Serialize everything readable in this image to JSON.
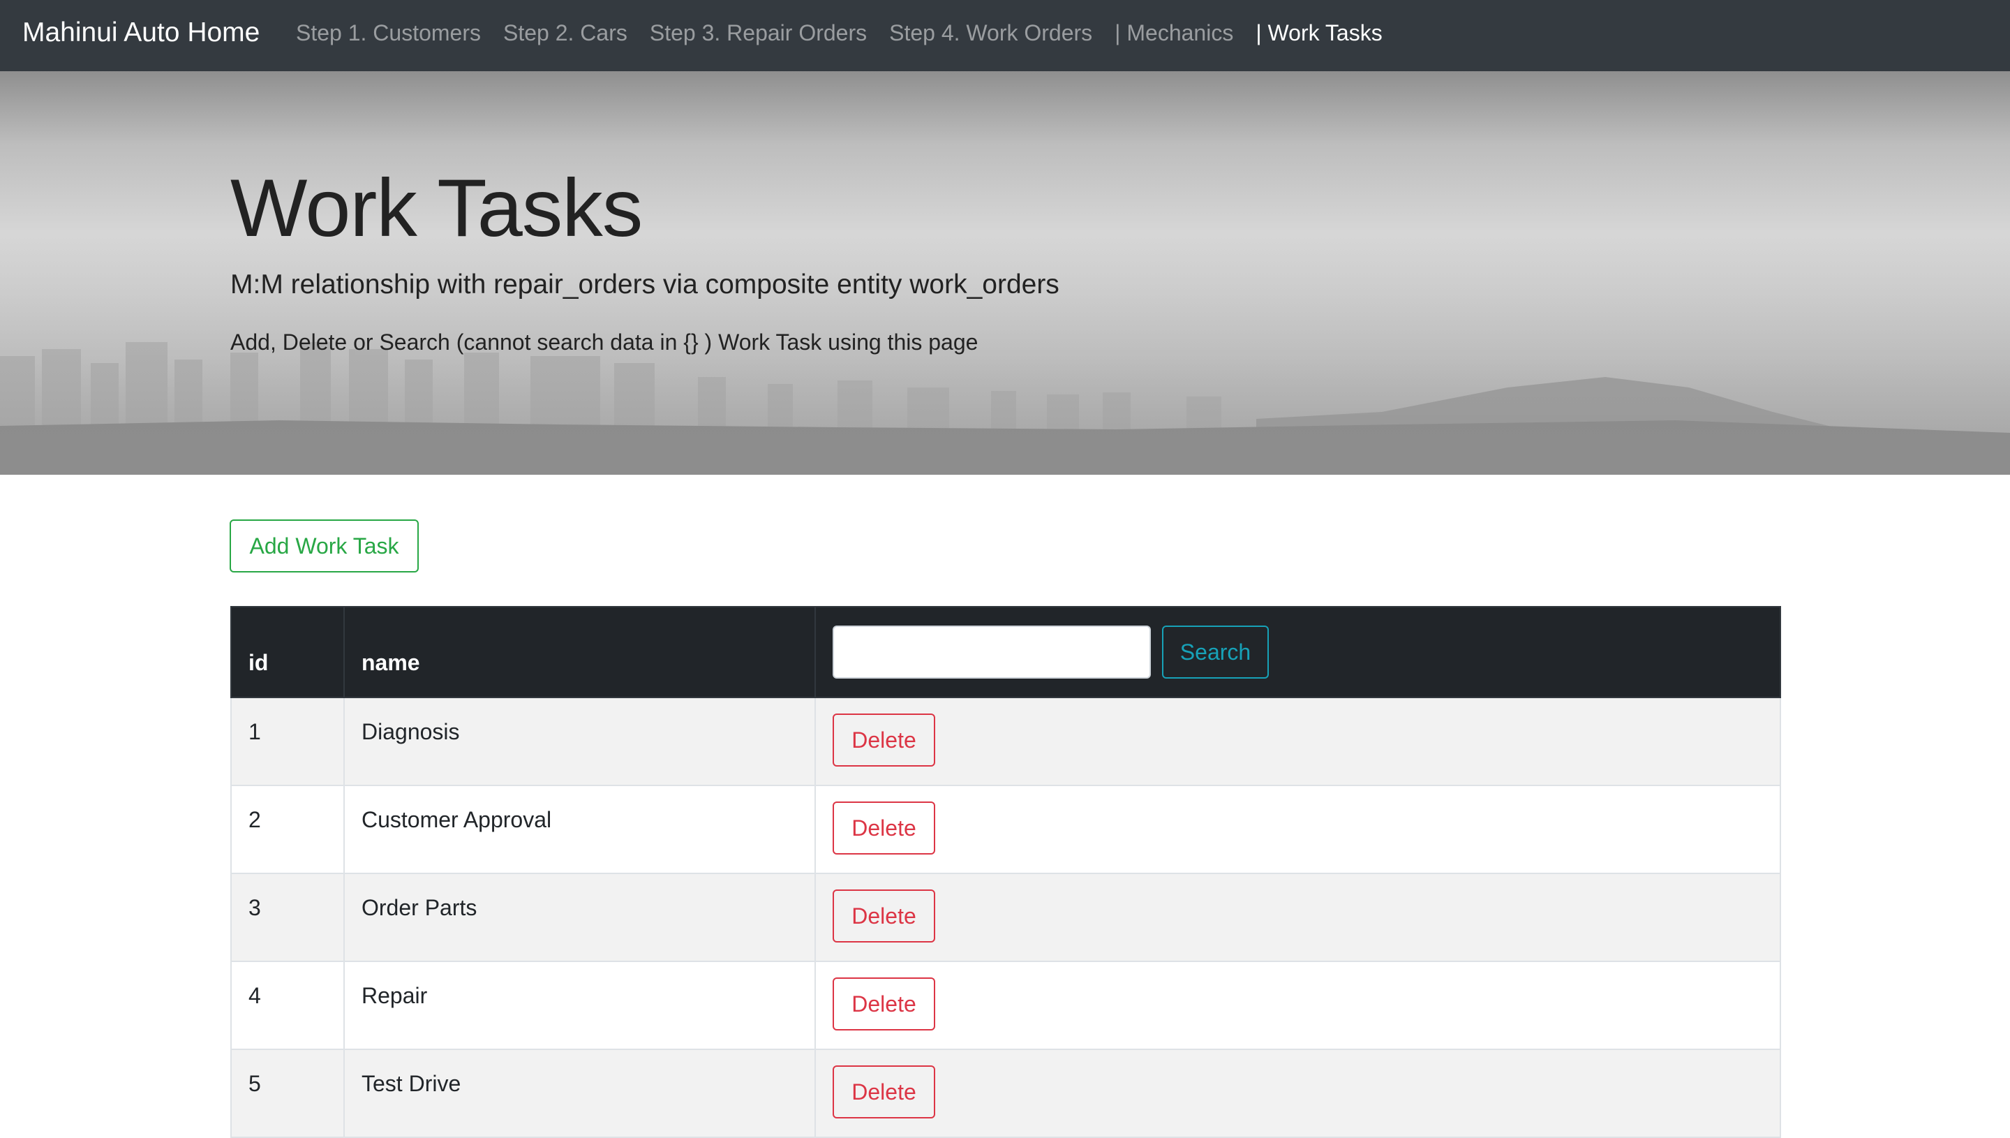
{
  "nav": {
    "brand": "Mahinui Auto Home",
    "links": [
      {
        "label": "Step 1. Customers"
      },
      {
        "label": "Step 2. Cars"
      },
      {
        "label": "Step 3. Repair Orders"
      },
      {
        "label": "Step 4. Work Orders"
      },
      {
        "label": "| Mechanics"
      },
      {
        "label": "| Work Tasks"
      }
    ]
  },
  "hero": {
    "title": "Work Tasks",
    "lead": "M:M relationship with repair_orders via composite entity work_orders",
    "text": "Add, Delete or Search (cannot search data in {} ) Work Task using this page"
  },
  "actions": {
    "add_label": "Add Work Task"
  },
  "table": {
    "headers": {
      "id": "id",
      "name": "name"
    },
    "search": {
      "value": "",
      "button_label": "Search"
    },
    "delete_label": "Delete",
    "rows": [
      {
        "id": "1",
        "name": "Diagnosis"
      },
      {
        "id": "2",
        "name": "Customer Approval"
      },
      {
        "id": "3",
        "name": "Order Parts"
      },
      {
        "id": "4",
        "name": "Repair"
      },
      {
        "id": "5",
        "name": "Test Drive"
      }
    ]
  }
}
